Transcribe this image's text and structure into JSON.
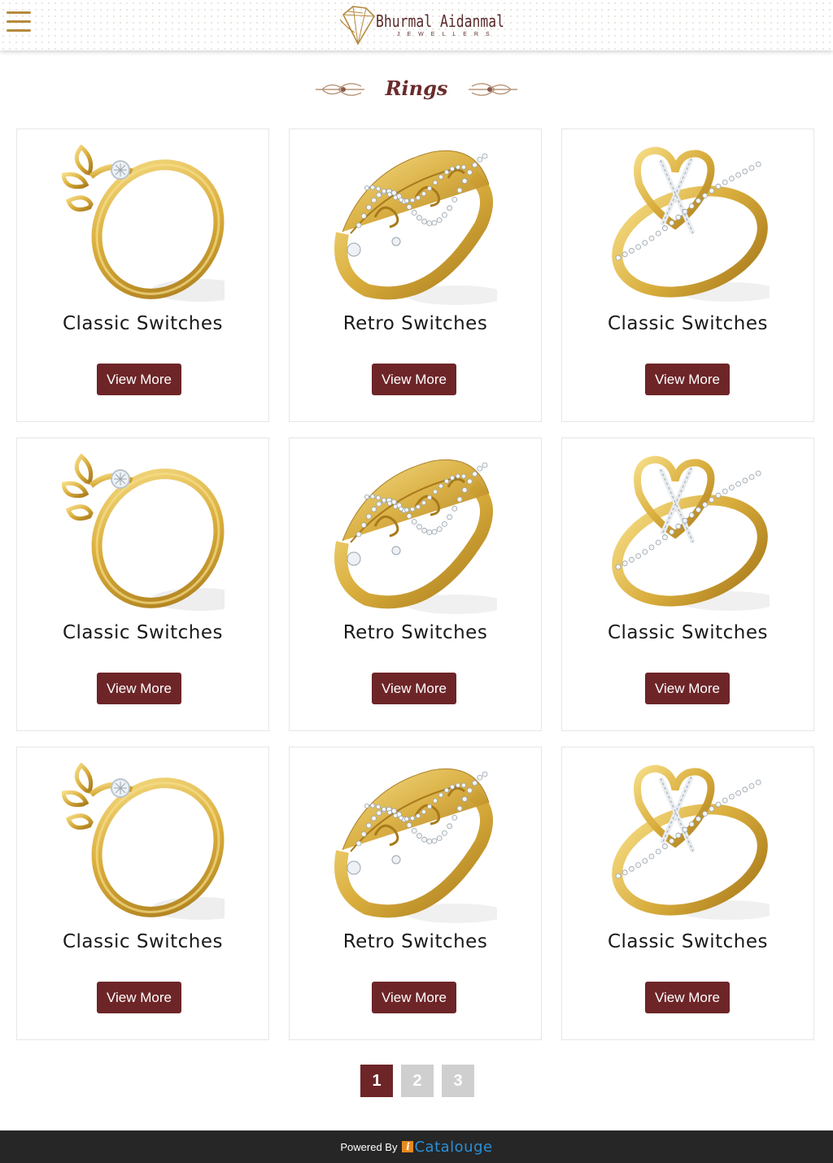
{
  "header": {
    "menu_icon": "hamburger-menu-icon",
    "logo": {
      "name": "Bhurmal Aidanmal",
      "tagline": "JEWELLERS"
    }
  },
  "page_title": "Rings",
  "colors": {
    "accent": "#6d2528",
    "gold": "#b68a3e",
    "footer_bg": "#262626",
    "brand_blue": "#2a8fd6"
  },
  "products": [
    {
      "name": "Classic Switches",
      "button": "View More",
      "image": "leaf-diamond-ring"
    },
    {
      "name": "Retro Switches",
      "button": "View More",
      "image": "filigree-diamond-ring"
    },
    {
      "name": "Classic Switches",
      "button": "View More",
      "image": "cross-heart-ring"
    },
    {
      "name": "Classic Switches",
      "button": "View More",
      "image": "leaf-diamond-ring"
    },
    {
      "name": "Retro Switches",
      "button": "View More",
      "image": "filigree-diamond-ring"
    },
    {
      "name": "Classic Switches",
      "button": "View More",
      "image": "cross-heart-ring"
    },
    {
      "name": "Classic Switches",
      "button": "View More",
      "image": "leaf-diamond-ring"
    },
    {
      "name": "Retro Switches",
      "button": "View More",
      "image": "filigree-diamond-ring"
    },
    {
      "name": "Classic Switches",
      "button": "View More",
      "image": "cross-heart-ring"
    }
  ],
  "pagination": {
    "pages": [
      "1",
      "2",
      "3"
    ],
    "current": "1"
  },
  "footer": {
    "powered_by": "Powered By",
    "brand_letter": "i",
    "brand_name": "Catalouge"
  }
}
